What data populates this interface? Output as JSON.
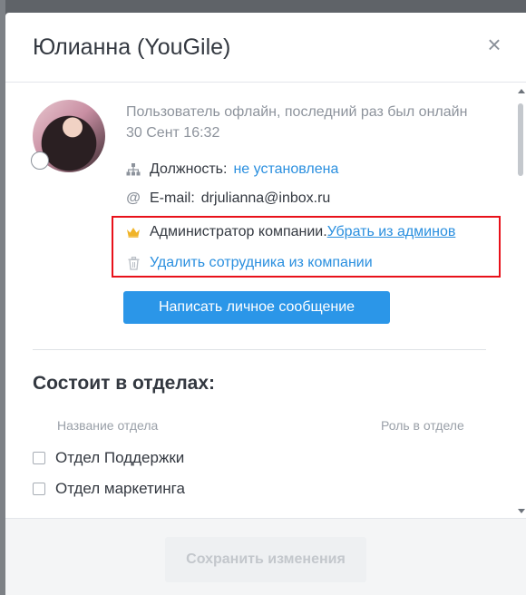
{
  "modal": {
    "title": "Юлианна (YouGile)",
    "close_glyph": "×"
  },
  "profile": {
    "status_text": "Пользователь офлайн, последний раз был онлайн 30 Сент 16:32",
    "position_label": "Должность:",
    "position_value": "не установлена",
    "email_label": "E-mail:",
    "email_value": "drjulianna@inbox.ru",
    "admin_text": "Администратор компании.",
    "remove_admin_link": "Убрать из админов",
    "delete_employee_link": "Удалить сотрудника из компании",
    "message_button": "Написать личное сообщение"
  },
  "departments": {
    "title": "Состоит в отделах:",
    "col_name": "Название отдела",
    "col_role": "Роль в отделе",
    "items": [
      {
        "name": "Отдел Поддержки",
        "checked": false
      },
      {
        "name": "Отдел маркетинга",
        "checked": false
      }
    ]
  },
  "footer": {
    "save_button": "Сохранить изменения"
  },
  "colors": {
    "accent": "#2b96e8",
    "link": "#2a8fdf",
    "highlight": "#e8111a",
    "crown": "#f0b429"
  },
  "icons": [
    "org-chart-icon",
    "at-sign-icon",
    "crown-icon",
    "trash-icon",
    "close-icon"
  ]
}
